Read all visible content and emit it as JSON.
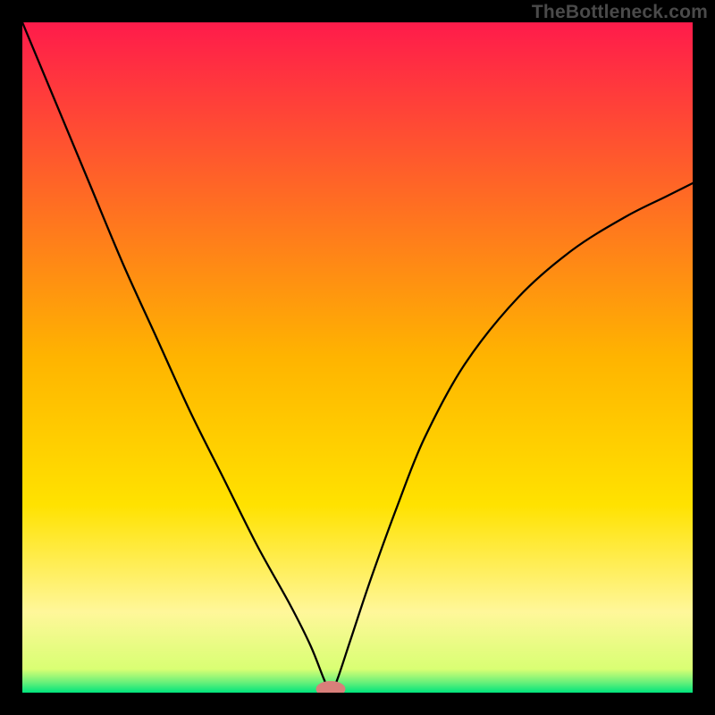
{
  "watermark": "TheBottleneck.com",
  "chart_data": {
    "type": "line",
    "title": "",
    "xlabel": "",
    "ylabel": "",
    "xlim": [
      0,
      100
    ],
    "ylim": [
      0,
      100
    ],
    "grid": false,
    "legend": false,
    "background_gradient_stops": [
      {
        "offset": 0.0,
        "color": "#ff1b4b"
      },
      {
        "offset": 0.5,
        "color": "#ffb400"
      },
      {
        "offset": 0.72,
        "color": "#ffe200"
      },
      {
        "offset": 0.88,
        "color": "#fff79a"
      },
      {
        "offset": 0.965,
        "color": "#d9ff73"
      },
      {
        "offset": 0.985,
        "color": "#66f07a"
      },
      {
        "offset": 1.0,
        "color": "#00e57c"
      }
    ],
    "marker": {
      "x": 46,
      "y": 0,
      "color": "#d97f7a",
      "rx": 2.2,
      "ry": 1.2
    },
    "series": [
      {
        "name": "bottleneck-curve",
        "color": "#000000",
        "x": [
          0,
          5,
          10,
          15,
          20,
          25,
          30,
          35,
          40,
          43,
          45,
          46,
          47,
          49,
          52,
          56,
          60,
          66,
          74,
          82,
          90,
          96,
          100
        ],
        "y": [
          100,
          88,
          76,
          64,
          53,
          42,
          32,
          22,
          13,
          7,
          2,
          0,
          2,
          8,
          17,
          28,
          38,
          49,
          59,
          66,
          71,
          74,
          76
        ]
      }
    ]
  }
}
